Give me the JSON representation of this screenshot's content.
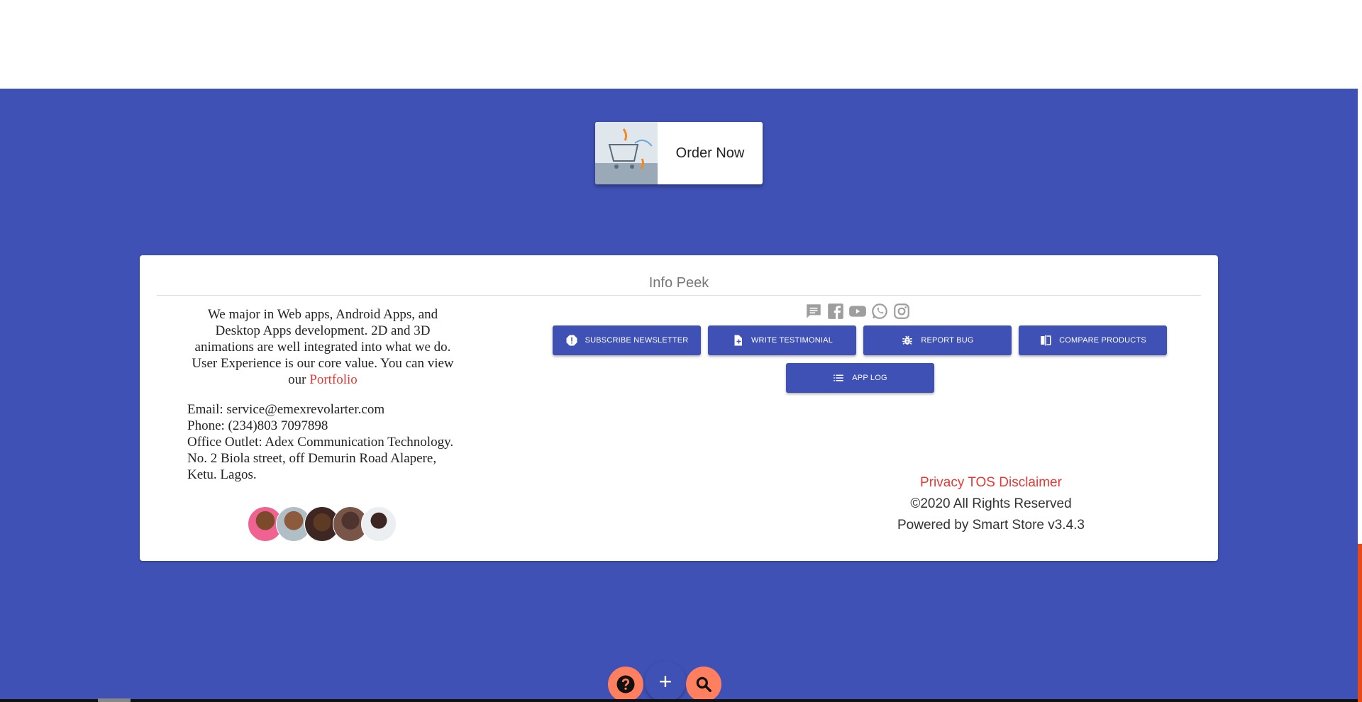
{
  "order": {
    "label": "Order Now"
  },
  "info": {
    "title": "Info Peek",
    "about": {
      "text": "We major in Web apps, Android Apps, and Desktop Apps development. 2D and 3D animations are well integrated into what we do. User Experience is our core value. You can view our",
      "link": "Portfolio"
    },
    "contact": {
      "email": "Email: service@emexrevolarter.com",
      "phone": "Phone: (234)803 7097898",
      "office": "Office Outlet: Adex Communication Technology. No. 2 Biola street, off Demurin Road Alapere, Ketu. Lagos."
    },
    "social_icons": [
      "chat-icon",
      "facebook-icon",
      "youtube-icon",
      "whatsapp-icon",
      "instagram-icon"
    ],
    "actions": [
      {
        "label": "SUBSCRIBE NEWSLETTER",
        "icon": "alert-circle-icon"
      },
      {
        "label": "WRITE TESTIMONIAL",
        "icon": "note-add-icon"
      },
      {
        "label": "REPORT BUG",
        "icon": "bug-icon"
      },
      {
        "label": "COMPARE PRODUCTS",
        "icon": "compare-icon"
      },
      {
        "label": "APP LOG",
        "icon": "list-icon"
      }
    ],
    "legal": {
      "privacy": "Privacy",
      "tos": "TOS",
      "disclaimer": "Disclaimer",
      "copyright": "©2020 All Rights Reserved",
      "powered": "Powered by Smart Store v3.4.3"
    }
  },
  "fab": {
    "add": "+"
  },
  "colors": {
    "primary": "#3f51b5",
    "accent": "#ff7f5f",
    "link": "#e53935"
  }
}
